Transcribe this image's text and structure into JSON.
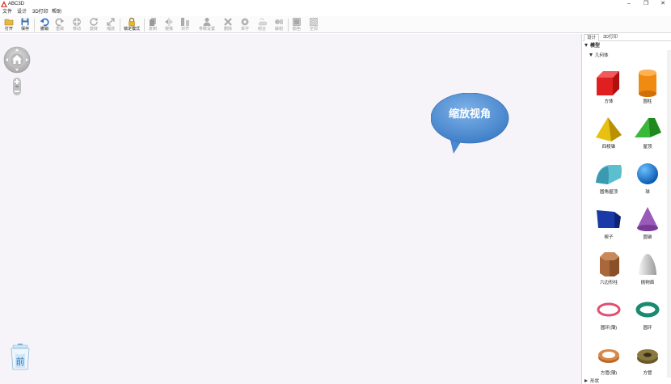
{
  "app": {
    "title": "ABC3D",
    "window_buttons": {
      "minimize": "–",
      "maximize": "❐",
      "close": "✕"
    }
  },
  "menu": [
    {
      "label": "文件"
    },
    {
      "label": "设计"
    },
    {
      "label": "3D打印"
    },
    {
      "label": "帮助"
    }
  ],
  "toolbar": [
    {
      "label": "打开",
      "icon": "open-folder-icon",
      "enabled": true
    },
    {
      "label": "保存",
      "icon": "save-disk-icon",
      "enabled": true
    },
    {
      "label": "撤销",
      "icon": "undo-icon",
      "enabled": true
    },
    {
      "label": "重做",
      "icon": "redo-icon",
      "enabled": false
    },
    {
      "label": "移动",
      "icon": "move-icon",
      "enabled": false
    },
    {
      "label": "旋转",
      "icon": "rotate-icon",
      "enabled": false
    },
    {
      "label": "缩放",
      "icon": "scale-icon",
      "enabled": false
    },
    {
      "label": "锁定模式",
      "icon": "lock-icon",
      "enabled": true
    },
    {
      "label": "复制",
      "icon": "copy-icon",
      "enabled": false
    },
    {
      "label": "镜像",
      "icon": "mirror-icon",
      "enabled": false
    },
    {
      "label": "对齐",
      "icon": "align-icon",
      "enabled": false
    },
    {
      "label": "参数设置",
      "icon": "params-icon",
      "enabled": false
    },
    {
      "label": "删除",
      "icon": "delete-icon",
      "enabled": false
    },
    {
      "label": "单字",
      "icon": "character-icon",
      "enabled": false
    },
    {
      "label": "组合",
      "icon": "group-icon",
      "enabled": false
    },
    {
      "label": "解组",
      "icon": "ungroup-icon",
      "enabled": false
    },
    {
      "label": "颜色",
      "icon": "color-icon",
      "enabled": false
    },
    {
      "label": "空洞",
      "icon": "hole-icon",
      "enabled": false
    }
  ],
  "canvas": {
    "tooltip_text": "缩放视角",
    "navigator_icon": "home-icon",
    "trash_icon": "trash-bin-icon"
  },
  "panel": {
    "tabs": [
      {
        "label": "设计",
        "active": true
      },
      {
        "label": "3D打印",
        "active": false
      }
    ],
    "section_title": "模型",
    "subsection_title": "几何体",
    "shapes": [
      {
        "label": "方体",
        "shape": "cube",
        "color": "#e02020"
      },
      {
        "label": "圆柱",
        "shape": "cylinder",
        "color": "#f08a10"
      },
      {
        "label": "四棱锥",
        "shape": "pyramid",
        "color": "#e8c010"
      },
      {
        "label": "屋顶",
        "shape": "roof",
        "color": "#2aa32a"
      },
      {
        "label": "圆角屋顶",
        "shape": "round-roof",
        "color": "#5bbfd0"
      },
      {
        "label": "球",
        "shape": "sphere",
        "color": "#1e80d8"
      },
      {
        "label": "楔子",
        "shape": "wedge",
        "color": "#1a3aa8"
      },
      {
        "label": "圆锥",
        "shape": "cone",
        "color": "#9a5ab8"
      },
      {
        "label": "六边形柱",
        "shape": "hex-prism",
        "color": "#a8683a"
      },
      {
        "label": "抛物面",
        "shape": "paraboloid",
        "color": "#d0d0d0"
      },
      {
        "label": "圆环(薄)",
        "shape": "thin-torus",
        "color": "#e05070"
      },
      {
        "label": "圆环",
        "shape": "torus",
        "color": "#1a8a70"
      },
      {
        "label": "方管(薄)",
        "shape": "thin-tube",
        "color": "#d8894a"
      },
      {
        "label": "方管",
        "shape": "tube",
        "color": "#8a7a40"
      }
    ],
    "bottom_section_title": "形状"
  }
}
